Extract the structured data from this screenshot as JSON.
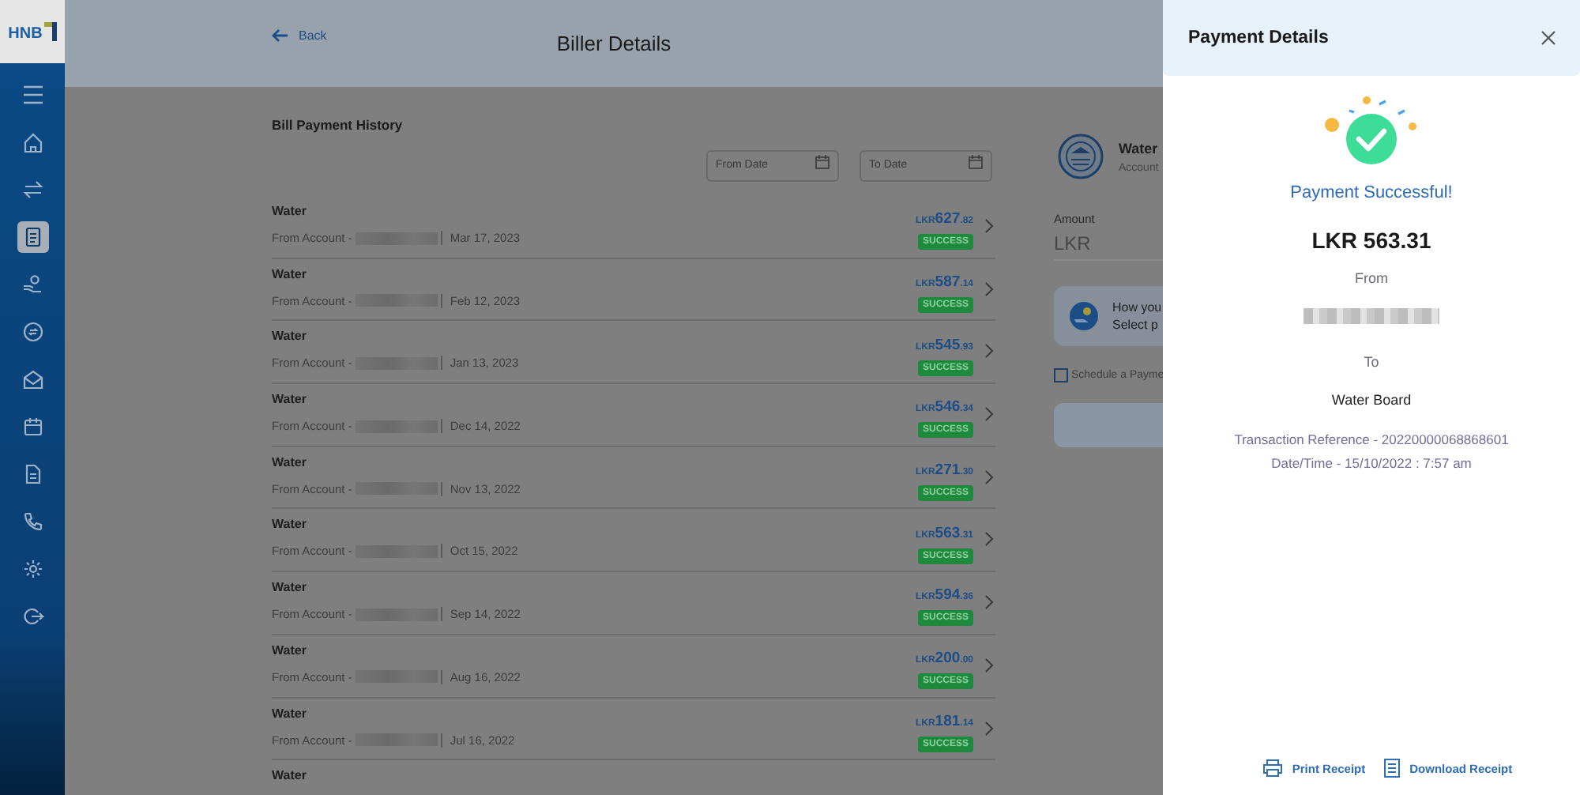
{
  "logo": "HNB",
  "nav_items": [
    {
      "selected": false
    },
    {
      "selected": false
    },
    {
      "selected": true
    },
    {
      "selected": false
    },
    {
      "selected": false
    },
    {
      "selected": false
    },
    {
      "selected": false
    },
    {
      "selected": false
    },
    {
      "selected": false
    },
    {
      "selected": false
    },
    {
      "selected": false
    }
  ],
  "header": {
    "back": "Back",
    "title": "Biller Details"
  },
  "history": {
    "title": "Bill Payment History",
    "from_date": {
      "placeholder": "From Date"
    },
    "to_date": {
      "placeholder": "To Date"
    },
    "rows": [
      {
        "biller": "Water",
        "from": "From Account -",
        "date": "Mar 17, 2023",
        "currency": "LKR",
        "amount": "627",
        "cents": ".82",
        "status": "SUCCESS"
      },
      {
        "biller": "Water",
        "from": "From Account -",
        "date": "Feb 12, 2023",
        "currency": "LKR",
        "amount": "587",
        "cents": ".14",
        "status": "SUCCESS"
      },
      {
        "biller": "Water",
        "from": "From Account -",
        "date": "Jan 13, 2023",
        "currency": "LKR",
        "amount": "545",
        "cents": ".93",
        "status": "SUCCESS"
      },
      {
        "biller": "Water",
        "from": "From Account -",
        "date": "Dec 14, 2022",
        "currency": "LKR",
        "amount": "546",
        "cents": ".34",
        "status": "SUCCESS"
      },
      {
        "biller": "Water",
        "from": "From Account -",
        "date": "Nov 13, 2022",
        "currency": "LKR",
        "amount": "271",
        "cents": ".30",
        "status": "SUCCESS"
      },
      {
        "biller": "Water",
        "from": "From Account -",
        "date": "Oct 15, 2022",
        "currency": "LKR",
        "amount": "563",
        "cents": ".31",
        "status": "SUCCESS"
      },
      {
        "biller": "Water",
        "from": "From Account -",
        "date": "Sep 14, 2022",
        "currency": "LKR",
        "amount": "594",
        "cents": ".36",
        "status": "SUCCESS"
      },
      {
        "biller": "Water",
        "from": "From Account -",
        "date": "Aug 16, 2022",
        "currency": "LKR",
        "amount": "200",
        "cents": ".00",
        "status": "SUCCESS"
      },
      {
        "biller": "Water",
        "from": "From Account -",
        "date": "Jul 16, 2022",
        "currency": "LKR",
        "amount": "181",
        "cents": ".14",
        "status": "SUCCESS"
      },
      {
        "biller": "Water"
      }
    ]
  },
  "biller_panel": {
    "name": "Water",
    "account": "Account",
    "amount_label": "Amount",
    "amount_placeholder": "LKR",
    "info_line_1": "How you",
    "info_line_2": "Select p",
    "schedule": {
      "label": "Schedule a Payme",
      "checked": false
    }
  },
  "drawer": {
    "title": "Payment Details",
    "status": "Payment Successful!",
    "amount": "LKR 563.31",
    "from_label": "From",
    "to_label": "To",
    "to_value": "Water Board",
    "reference": "Transaction Reference - 20220000068868601",
    "datetime": "Date/Time - 15/10/2022 : 7:57 am",
    "actions": [
      "Print Receipt",
      "Download Receipt"
    ]
  }
}
